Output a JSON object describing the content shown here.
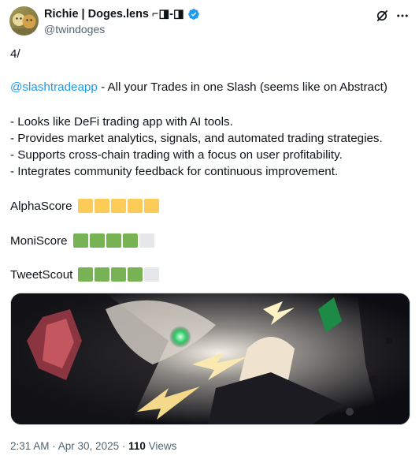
{
  "author": {
    "display_name": "Richie | Doges.lens ⌐◨-◨",
    "handle": "@twindoges",
    "verified_color": "#1d9bf0"
  },
  "header_icons": [
    "grok-icon",
    "more-icon"
  ],
  "tweet": {
    "line_thread": "4/",
    "mention": "@slashtradeapp",
    "mention_rest": " - All your Trades in one Slash (seems like on Abstract)",
    "bullets": [
      "- Looks like DeFi trading app with AI tools.",
      "- Provides market analytics, signals, and automated trading strategies.",
      "- Supports cross-chain trading with a focus on user profitability.",
      "- Integrates community feedback for continuous improvement."
    ]
  },
  "scores": [
    {
      "label": "AlphaScore",
      "filled": 5,
      "total": 5,
      "color": "#fdcb58"
    },
    {
      "label": "MoniScore",
      "filled": 4,
      "total": 5,
      "color": "#77b255"
    },
    {
      "label": "TweetScout",
      "filled": 4,
      "total": 5,
      "color": "#77b255"
    }
  ],
  "media": {
    "alt": "anime-style illustration with lightning and green glowing eyes"
  },
  "meta": {
    "timestamp": "2:31 AM · Apr 30, 2025 · ",
    "views_count": "110",
    "views_label": " Views"
  },
  "colors": {
    "link": "#1d9bf0",
    "secondary_text": "#536471"
  }
}
